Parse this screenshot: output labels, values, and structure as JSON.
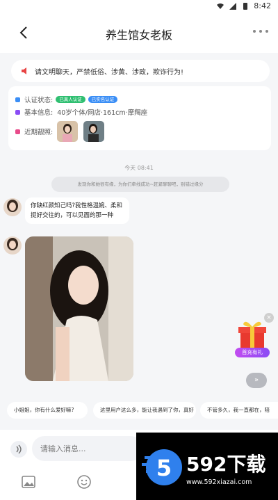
{
  "status": {
    "time": "8:42"
  },
  "header": {
    "title": "养生馆女老板"
  },
  "notice": {
    "text": "请文明聊天，严禁低俗、涉黄、涉政，欺诈行为!"
  },
  "profile": {
    "cert_label": "认证状态:",
    "cert_badges": [
      "已真人认证",
      "已实名认证"
    ],
    "info_label": "基本信息:",
    "info_value": "40岁个体/网店·161cm·摩羯座",
    "recent_label": "近期靓照:"
  },
  "chat": {
    "time": "今天 08:41",
    "system_msg": "发现你和她很有缘，为你们牵线成功~赶紧聊聊吧，别错过缘分",
    "message_text": "你缺红颜知己吗?我性格温婉、柔和挺好交往的，可以见面的那一种"
  },
  "gift": {
    "label": "首充有礼",
    "close": "×"
  },
  "forward": {
    "label": "»"
  },
  "quick_replies": [
    "小姐姐，你有什么爱好嘛?",
    "这里用户这么多，能让我遇到了你，真好",
    "不管多久，我一直都在，陪"
  ],
  "input": {
    "placeholder": "请输入消息..."
  },
  "watermark": {
    "brand": "592下载",
    "url": "www.592xiazai.com",
    "logo_digit": "5"
  },
  "colors": {
    "accent": "#8a4cf5",
    "badge_green": "#2fbf71",
    "badge_blue": "#3a8ef6"
  }
}
